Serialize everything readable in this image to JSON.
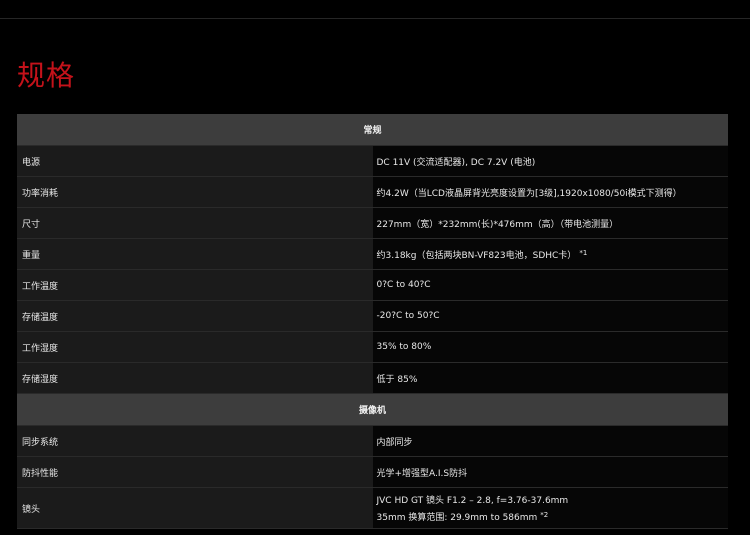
{
  "colors": {
    "background": "#000000",
    "title": "#c4121a",
    "section_header": "#3d3d3d",
    "label_cell": "#1b1b1b",
    "value_cell": "#060606"
  },
  "page": {
    "title": "规格"
  },
  "spec_table": {
    "sections": [
      {
        "header": "常规",
        "rows": [
          {
            "label": "电源",
            "value": "DC 11V (交流适配器), DC 7.2V (电池)"
          },
          {
            "label": "功率消耗",
            "value": "约4.2W（当LCD液晶屏背光亮度设置为[3级],1920x1080/50i模式下测得）"
          },
          {
            "label": "尺寸",
            "value": "227mm（宽）*232mm(长)*476mm（高）（带电池测量）"
          },
          {
            "label": "重量",
            "value": "约3.18kg（包括两块BN-VF823电池，SDHC卡）",
            "note": "*1"
          },
          {
            "label": "工作温度",
            "value": "0?C to 40?C"
          },
          {
            "label": "存储温度",
            "value": "-20?C to 50?C"
          },
          {
            "label": "工作湿度",
            "value": "35% to 80%"
          },
          {
            "label": "存储湿度",
            "value": "低于 85%"
          }
        ]
      },
      {
        "header": "摄像机",
        "rows": [
          {
            "label": "同步系统",
            "value": "内部同步"
          },
          {
            "label": "防抖性能",
            "value": "光学+增强型A.I.S防抖"
          },
          {
            "label": "镜头",
            "value": "JVC HD GT 镜头 F1.2 – 2.8, f=3.76-37.6mm",
            "value_line2": "35mm 换算范围: 29.9mm to 586mm",
            "note": "*2"
          }
        ]
      }
    ]
  }
}
